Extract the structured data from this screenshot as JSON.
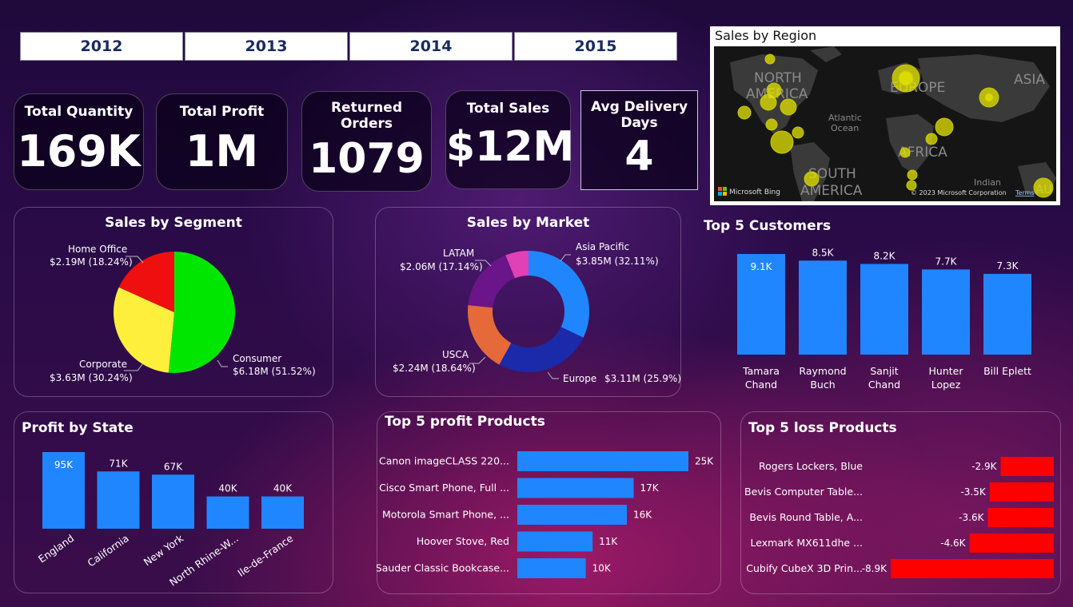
{
  "years": [
    "2012",
    "2013",
    "2014",
    "2015"
  ],
  "kpis": {
    "total_quantity": {
      "label": "Total Quantity",
      "value": "169K"
    },
    "total_profit": {
      "label": "Total Profit",
      "value": "1M"
    },
    "returned_orders": {
      "label1": "Returned",
      "label2": "Orders",
      "value": "1079"
    },
    "total_sales": {
      "label": "Total Sales",
      "value": "$12M"
    },
    "avg_delivery": {
      "label1": "Avg Delivery",
      "label2": "Days",
      "value": "4"
    }
  },
  "map": {
    "title": "Sales by Region",
    "labels": {
      "north_america_1": "NORTH",
      "north_america_2": "AMERICA",
      "europe": "EUROPE",
      "asia": "ASIA",
      "africa": "AFRICA",
      "south_america_1": "SOUTH",
      "south_america_2": "AMERICA",
      "atlantic_1": "Atlantic",
      "atlantic_2": "Ocean",
      "indian": "Indian",
      "au": "AU"
    },
    "bing": "Microsoft Bing",
    "copyright": "© 2023 Microsoft Corporation",
    "terms": "Terms",
    "colors": {
      "bubble": "#e6e600",
      "land": "#3a3a3a",
      "water": "#151515"
    }
  },
  "chart_data": [
    {
      "id": "segment",
      "type": "pie",
      "title": "Sales by Segment",
      "slices": [
        {
          "name": "Consumer",
          "value": 6.18,
          "label": "$6.18M (51.52%)",
          "pct": 51.52,
          "color": "#00e600"
        },
        {
          "name": "Corporate",
          "value": 3.63,
          "label": "$3.63M (30.24%)",
          "pct": 30.24,
          "color": "#ffef3d"
        },
        {
          "name": "Home Office",
          "value": 2.19,
          "label": "$2.19M (18.24%)",
          "pct": 18.24,
          "color": "#ef0f0f"
        }
      ]
    },
    {
      "id": "market",
      "type": "pie",
      "title": "Sales by Market",
      "slices": [
        {
          "name": "Asia Pacific",
          "value": 3.85,
          "label": "$3.85M (32.11%)",
          "pct": 32.11,
          "color": "#1f86ff"
        },
        {
          "name": "Europe",
          "value": 3.11,
          "label": "$3.11M (25.9%)",
          "pct": 25.9,
          "color": "#1a2aa8"
        },
        {
          "name": "USCA",
          "value": 2.24,
          "label": "$2.24M (18.64%)",
          "pct": 18.64,
          "color": "#e6693a"
        },
        {
          "name": "LATAM",
          "value": 2.06,
          "label": "$2.06M (17.14%)",
          "pct": 17.14,
          "color": "#6a1589"
        },
        {
          "name": "",
          "value": 0.74,
          "label": "",
          "pct": 6.21,
          "color": "#e040b8"
        }
      ]
    },
    {
      "id": "customers",
      "type": "bar",
      "title": "Top 5 Customers",
      "categories": [
        "Tamara Chand",
        "Raymond Buch",
        "Sanjit Chand",
        "Hunter Lopez",
        "Bill Eplett"
      ],
      "values": [
        9.1,
        8.5,
        8.2,
        7.7,
        7.3
      ],
      "value_labels": [
        "9.1K",
        "8.5K",
        "8.2K",
        "7.7K",
        "7.3K"
      ],
      "color": "#1f86ff"
    },
    {
      "id": "state",
      "type": "bar",
      "title": "Profit by State",
      "categories": [
        "England",
        "California",
        "New York",
        "North Rhine-W...",
        "Ile-de-France"
      ],
      "values": [
        95,
        71,
        67,
        40,
        40
      ],
      "value_labels": [
        "95K",
        "71K",
        "67K",
        "40K",
        "40K"
      ],
      "color": "#1f86ff"
    },
    {
      "id": "profit_products",
      "type": "bar",
      "orientation": "horizontal",
      "title": "Top 5 profit Products",
      "categories": [
        "Canon imageCLASS 220...",
        "Cisco Smart Phone, Full ...",
        "Motorola Smart Phone, ...",
        "Hoover Stove, Red",
        "Sauder Classic Bookcase..."
      ],
      "values": [
        25,
        17,
        16,
        11,
        10
      ],
      "value_labels": [
        "25K",
        "17K",
        "16K",
        "11K",
        "10K"
      ],
      "color": "#1f86ff"
    },
    {
      "id": "loss_products",
      "type": "bar",
      "orientation": "horizontal",
      "title": "Top 5 loss Products",
      "categories": [
        "Rogers Lockers, Blue",
        "Bevis Computer Table...",
        "Bevis Round Table, A...",
        "Lexmark MX611dhe ...",
        "Cubify CubeX 3D Prin..."
      ],
      "values": [
        -2.9,
        -3.5,
        -3.6,
        -4.6,
        -8.9
      ],
      "value_labels": [
        "-2.9K",
        "-3.5K",
        "-3.6K",
        "-4.6K",
        "-8.9K"
      ],
      "color": "#ff0000"
    }
  ]
}
